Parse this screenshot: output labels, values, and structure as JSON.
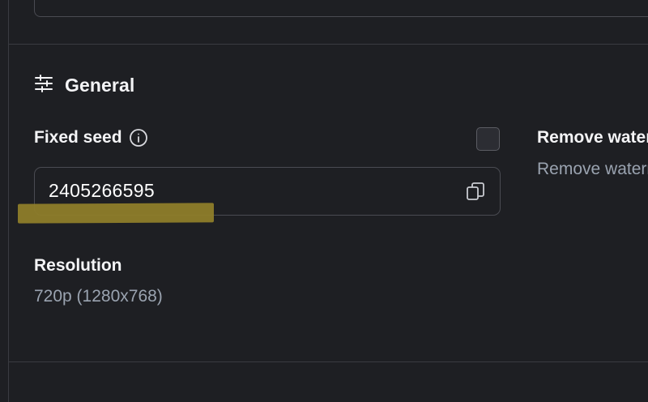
{
  "section": {
    "title": "General",
    "icon": "sliders-icon"
  },
  "seed": {
    "label": "Fixed seed",
    "info_icon": "info-icon",
    "value": "2405266595",
    "copy_icon": "copy-icon"
  },
  "watermark": {
    "checked": false,
    "title": "Remove watermark",
    "description": "Remove watermark"
  },
  "resolution": {
    "label": "Resolution",
    "value": "720p (1280x768)"
  },
  "colors": {
    "background": "#1e1f23",
    "border": "#4a4b52",
    "text_primary": "#f4f4f6",
    "text_secondary": "#9aa3b0",
    "highlight": "#8e7d2a"
  }
}
